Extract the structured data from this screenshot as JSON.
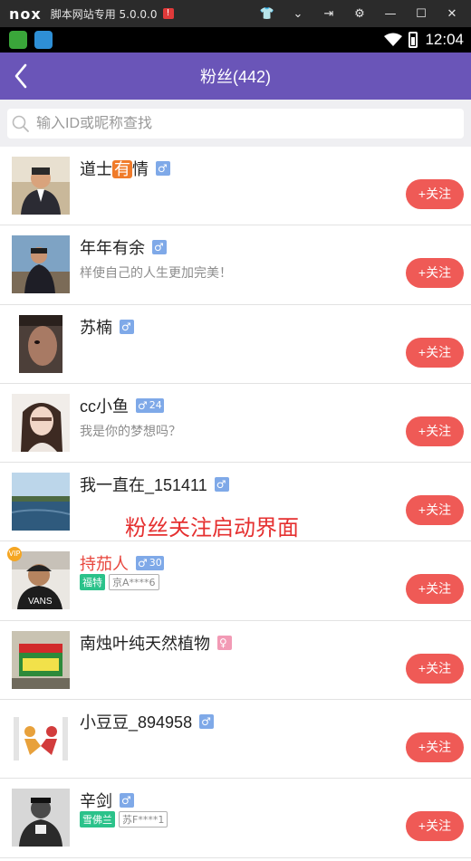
{
  "emulator": {
    "logo": "nox",
    "title": "脚本网站专用 5.0.0.0",
    "warn": "!",
    "controls": [
      {
        "icon": "shirt-icon",
        "glyph": "👕"
      },
      {
        "icon": "chevron-down-icon",
        "glyph": "⌄"
      },
      {
        "icon": "pin-icon",
        "glyph": "⇥"
      },
      {
        "icon": "gear-icon",
        "glyph": "⚙"
      },
      {
        "icon": "minimize-icon",
        "glyph": "—"
      },
      {
        "icon": "maximize-icon",
        "glyph": "☐"
      },
      {
        "icon": "close-icon",
        "glyph": "✕"
      }
    ]
  },
  "status_bar": {
    "time": "12:04"
  },
  "header": {
    "title": "粉丝(442)"
  },
  "search": {
    "placeholder": "输入ID或昵称查找"
  },
  "follow_label": "+关注",
  "caption": "粉丝关注启动界面",
  "users": [
    {
      "name_pre": "道士",
      "name_hl": "有",
      "name_post": "情",
      "gender": "male",
      "age": "",
      "sub": "",
      "car": "",
      "plate": "",
      "red": false,
      "vip": false,
      "avatar": "man-suit"
    },
    {
      "name_pre": "年年有余",
      "name_hl": "",
      "name_post": "",
      "gender": "male",
      "age": "",
      "sub": "样使自己的人生更加完美！",
      "car": "",
      "plate": "",
      "red": false,
      "vip": false,
      "avatar": "man-outdoor"
    },
    {
      "name_pre": "苏楠",
      "name_hl": "",
      "name_post": "",
      "gender": "male",
      "age": "",
      "sub": "",
      "car": "",
      "plate": "",
      "red": false,
      "vip": false,
      "avatar": "dark-face"
    },
    {
      "name_pre": "cc小鱼",
      "name_hl": "",
      "name_post": "",
      "gender": "male",
      "age": "24",
      "sub": "我是你的梦想吗？",
      "car": "",
      "plate": "",
      "red": false,
      "vip": false,
      "avatar": "girl"
    },
    {
      "name_pre": "我一直在_151411",
      "name_hl": "",
      "name_post": "",
      "gender": "male",
      "age": "",
      "sub": "",
      "car": "",
      "plate": "",
      "red": false,
      "vip": false,
      "avatar": "lake"
    },
    {
      "name_pre": "持茄人",
      "name_hl": "",
      "name_post": "",
      "gender": "male",
      "age": "30",
      "sub": "",
      "car": "福特",
      "plate": "京A****6",
      "red": true,
      "vip": true,
      "avatar": "man-cap"
    },
    {
      "name_pre": "南烛叶纯天然植物",
      "name_hl": "",
      "name_post": "",
      "gender": "female",
      "age": "",
      "sub": "",
      "car": "",
      "plate": "",
      "red": false,
      "vip": false,
      "avatar": "product"
    },
    {
      "name_pre": "小豆豆_894958",
      "name_hl": "",
      "name_post": "",
      "gender": "male",
      "age": "",
      "sub": "",
      "car": "",
      "plate": "",
      "red": false,
      "vip": false,
      "avatar": "handshake"
    },
    {
      "name_pre": "辛剑",
      "name_hl": "",
      "name_post": "",
      "gender": "male",
      "age": "",
      "sub": "",
      "car": "雪佛兰",
      "plate": "苏F****1",
      "red": false,
      "vip": false,
      "avatar": "man-bw"
    }
  ],
  "glyphs": {
    "male": "♂",
    "female": "♀",
    "vip": "VIP"
  }
}
